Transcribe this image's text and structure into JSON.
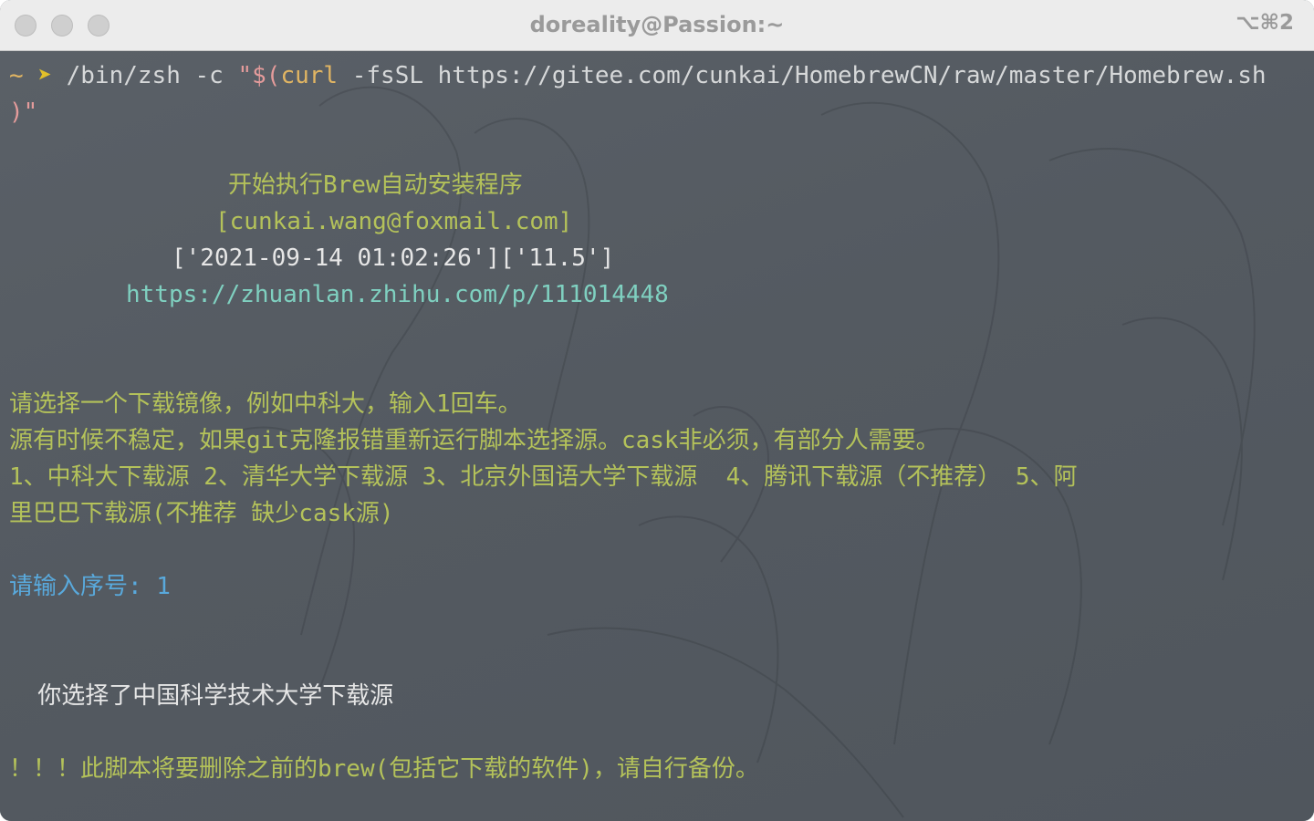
{
  "window": {
    "title": "doreality@Passion:~",
    "shortcut": "⌥⌘2"
  },
  "terminal": {
    "prompt": {
      "tilde": "~",
      "arrow": "➤",
      "command": "/bin/zsh",
      "flag": "-c",
      "quote_open": "\"$(",
      "curl": "curl",
      "curl_args": "-fsSL https://gitee.com/cunkai/HomebrewCN/raw/master/Homebrew.sh",
      "quote_close": ")\""
    },
    "banner": {
      "title": "开始执行Brew自动安装程序",
      "email": "[cunkai.wang@foxmail.com]",
      "version": "['2021-09-14 01:02:26']['11.5']",
      "url": "https://zhuanlan.zhihu.com/p/111014448"
    },
    "mirror_prompt": {
      "line1": "请选择一个下载镜像，例如中科大，输入1回车。",
      "line2": "源有时候不稳定，如果git克隆报错重新运行脚本选择源。cask非必须，有部分人需要。",
      "line3": "1、中科大下载源 2、清华大学下载源 3、北京外国语大学下载源  4、腾讯下载源（不推荐） 5、阿",
      "line4": "里巴巴下载源(不推荐 缺少cask源)"
    },
    "input_prompt": "请输入序号: 1",
    "selection": "  你选择了中国科学技术大学下载源",
    "warning": "！！！此脚本将要删除之前的brew(包括它下载的软件)，请自行备份。"
  },
  "colors": {
    "background": "#545a61",
    "yellow_green": "#b4c25a",
    "cyan": "#7fd0c0",
    "blue": "#59a9dc",
    "pink": "#e49b9b",
    "titlebar": "#ececec"
  }
}
